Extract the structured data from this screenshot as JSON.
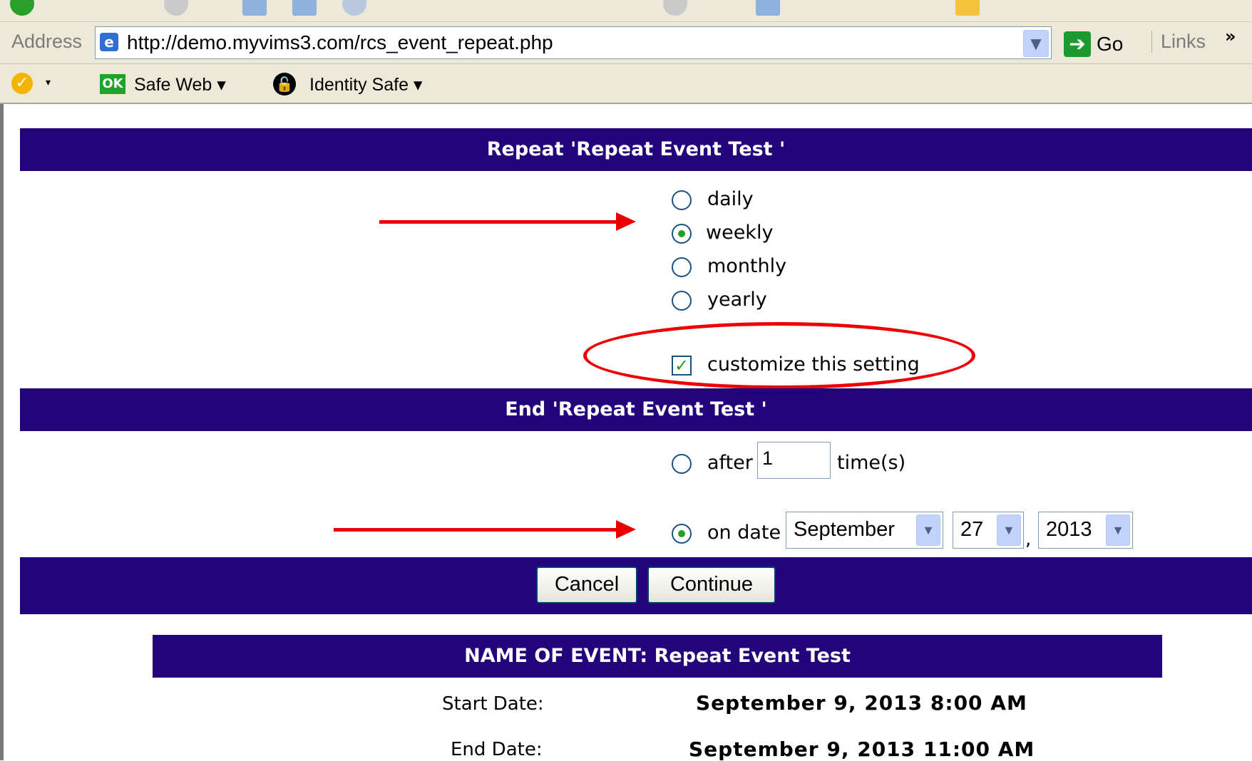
{
  "browser": {
    "address_label": "Address",
    "url": "http://demo.myvims3.com/rcs_event_repeat.php",
    "go_label": "Go",
    "links_label": "Links",
    "chevron": "»",
    "dropdown_icon": "chevron-down-icon"
  },
  "norton": {
    "safe_web_badge": "OK",
    "safe_web_label": "Safe Web ▾",
    "identity_safe_label": "Identity Safe ▾",
    "caret": "▾"
  },
  "repeat_section": {
    "title": "Repeat 'Repeat Event Test '",
    "options": [
      {
        "label": "daily",
        "checked": false
      },
      {
        "label": "weekly",
        "checked": true
      },
      {
        "label": "monthly",
        "checked": false
      },
      {
        "label": "yearly",
        "checked": false
      }
    ],
    "customize_label": "customize this setting",
    "customize_checked": true
  },
  "end_section": {
    "title": "End 'Repeat Event Test '",
    "after_label": "after",
    "after_value": "1",
    "times_label": "time(s)",
    "after_checked": false,
    "on_date_label": "on date",
    "on_date_checked": true,
    "month": "September",
    "day": "27",
    "comma": ",",
    "year": "2013"
  },
  "buttons": {
    "cancel": "Cancel",
    "continue": "Continue"
  },
  "event_info": {
    "title": "NAME OF EVENT: Repeat Event Test",
    "start_label": "Start Date:",
    "start_value": "September 9, 2013 8:00 AM",
    "end_label": "End Date:",
    "end_value": "September 9, 2013 11:00 AM"
  },
  "colors": {
    "band": "#24047b",
    "annotation": "#ee0000",
    "radio_fill": "#21a121"
  }
}
